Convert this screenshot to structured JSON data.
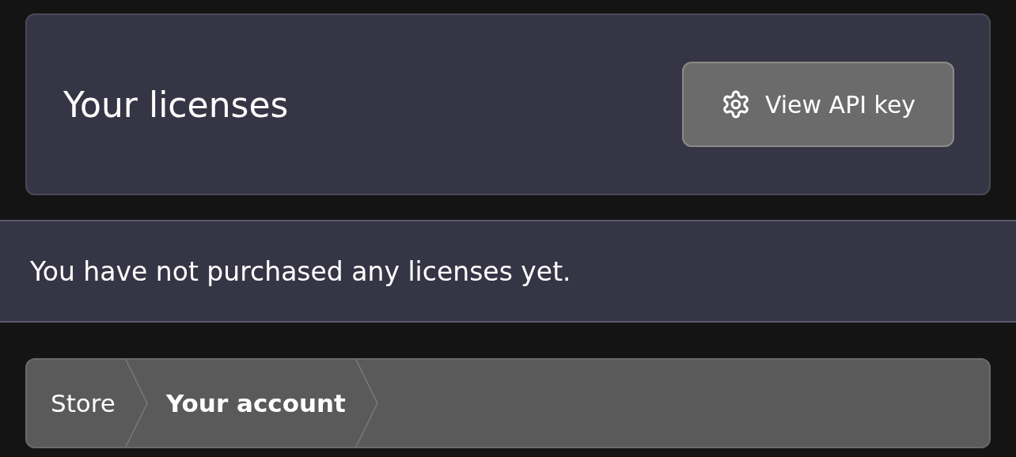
{
  "header": {
    "title": "Your licenses",
    "button": {
      "label": "View API key"
    }
  },
  "notice": "You have not purchased any licenses yet.",
  "breadcrumb": [
    {
      "label": "Store",
      "selected": false
    },
    {
      "label": "Your account",
      "selected": true
    }
  ]
}
